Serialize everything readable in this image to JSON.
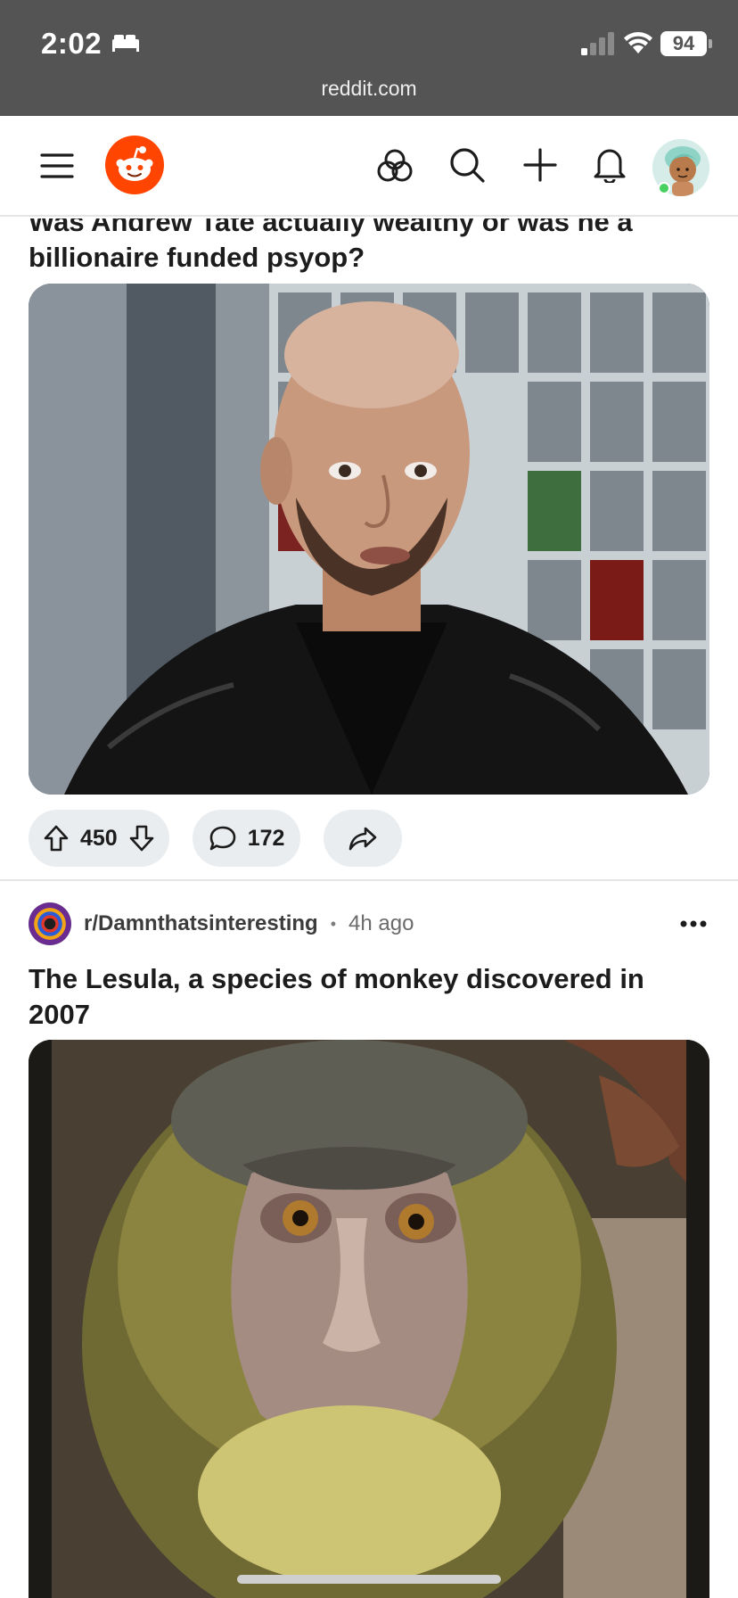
{
  "status_bar": {
    "time": "2:02",
    "battery": "94",
    "url": "reddit.com"
  },
  "header": {
    "icons": [
      "menu-icon",
      "reddit-logo",
      "explore-icon",
      "search-icon",
      "create-post-icon",
      "notification-bell-icon",
      "user-avatar"
    ]
  },
  "posts": [
    {
      "title": "Was Andrew Tate actually wealthy or was he a billionaire funded psyop?",
      "upvotes": "450",
      "comments": "172"
    },
    {
      "subreddit": "r/Damnthatsinteresting",
      "separator": "•",
      "time_ago": "4h ago",
      "title": "The Lesula, a species of monkey discovered in 2007"
    }
  ],
  "colors": {
    "reddit_orange": "#ff4500",
    "status_bar": "#545454",
    "pill_bg": "#eaedef"
  }
}
